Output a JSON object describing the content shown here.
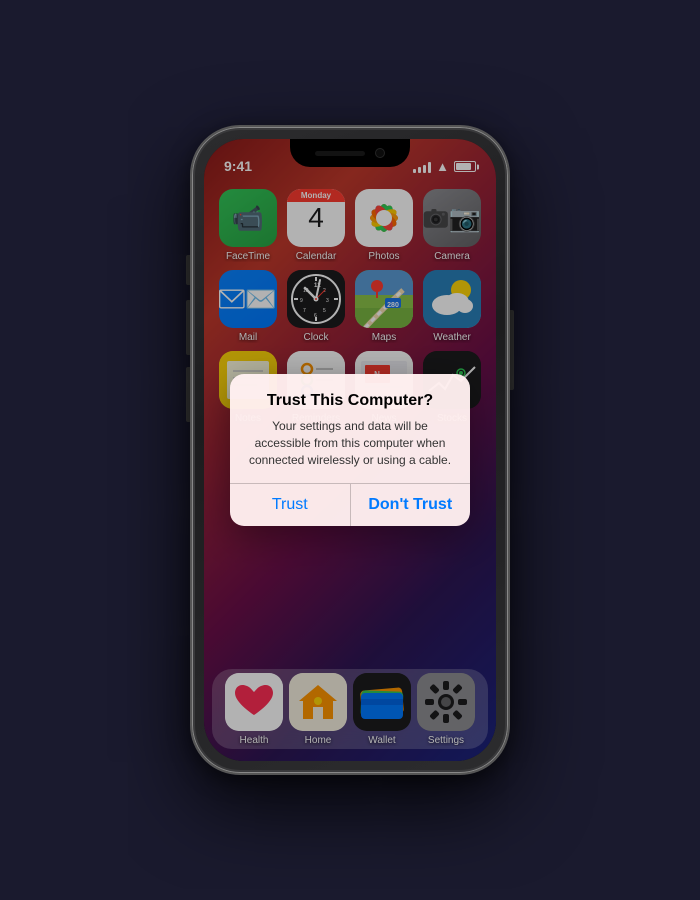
{
  "status_bar": {
    "time": "9:41"
  },
  "apps": {
    "row1": [
      {
        "id": "facetime",
        "label": "FaceTime"
      },
      {
        "id": "calendar",
        "label": "Calendar",
        "day": "Monday",
        "date": "4"
      },
      {
        "id": "photos",
        "label": "Photos"
      },
      {
        "id": "camera",
        "label": "Camera"
      }
    ],
    "row2": [
      {
        "id": "mail",
        "label": "Mail"
      },
      {
        "id": "clock",
        "label": "Clock"
      },
      {
        "id": "maps",
        "label": "Maps"
      },
      {
        "id": "weather",
        "label": "Weather"
      }
    ],
    "row3": [
      {
        "id": "notes",
        "label": "Notes"
      },
      {
        "id": "reminders",
        "label": "Reminders"
      },
      {
        "id": "news",
        "label": "News"
      },
      {
        "id": "stocks",
        "label": "Stocks"
      }
    ],
    "dock": [
      {
        "id": "health",
        "label": "Health"
      },
      {
        "id": "home",
        "label": "Home"
      },
      {
        "id": "wallet",
        "label": "Wallet"
      },
      {
        "id": "settings",
        "label": "Settings"
      }
    ]
  },
  "alert": {
    "title": "Trust This Computer?",
    "message": "Your settings and data will be accessible from this computer when connected wirelessly or using a cable.",
    "btn_trust": "Trust",
    "btn_dont_trust": "Don't Trust"
  }
}
